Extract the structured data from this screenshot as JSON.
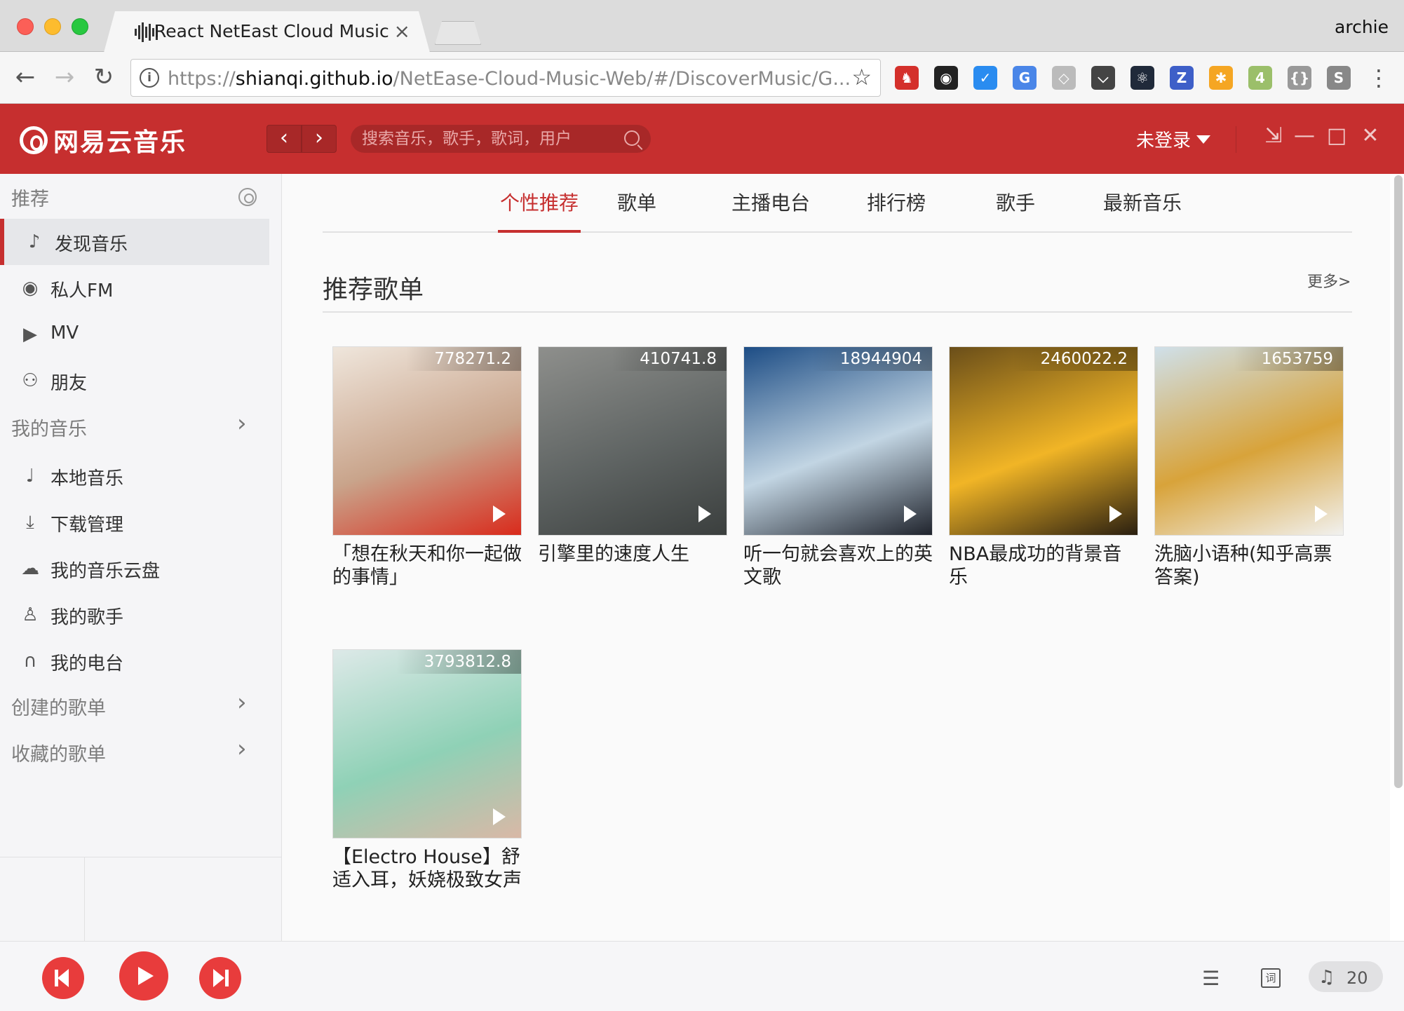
{
  "browser": {
    "tab_title": "React NetEast Cloud Music",
    "profile_name": "archie",
    "url_scheme": "https://",
    "url_host": "shianqi.github.io",
    "url_path": "/NetEase-Cloud-Music-Web/#/DiscoverMusic/G...",
    "extensions": [
      {
        "name": "red-horse-extension-icon",
        "color": "#d4302b",
        "glyph": "♞"
      },
      {
        "name": "spy-glasses-extension-icon",
        "color": "#222222",
        "glyph": "◉"
      },
      {
        "name": "pocket-save-extension-icon",
        "color": "#2a8cf0",
        "glyph": "✓"
      },
      {
        "name": "translate-extension-icon",
        "color": "#4a86e8",
        "glyph": "G"
      },
      {
        "name": "shield-extension-icon",
        "color": "#bbbbbb",
        "glyph": "◇"
      },
      {
        "name": "pocket-extension-icon",
        "color": "#444444",
        "glyph": "⌵"
      },
      {
        "name": "react-devtools-icon",
        "color": "#202a3a",
        "glyph": "⚛"
      },
      {
        "name": "z-extension-icon",
        "color": "#3e5fc8",
        "glyph": "Z"
      },
      {
        "name": "pinwheel-extension-icon",
        "color": "#f5a623",
        "glyph": "✱"
      },
      {
        "name": "badge-extension-icon",
        "color": "#9bbf6a",
        "glyph": "4"
      },
      {
        "name": "json-extension-icon",
        "color": "#999999",
        "glyph": "{}"
      },
      {
        "name": "s-extension-icon",
        "color": "#888888",
        "glyph": "S"
      }
    ]
  },
  "header": {
    "logo_text": "网易云音乐",
    "search_placeholder": "搜索音乐，歌手，歌词，用户",
    "login_label": "未登录"
  },
  "sidebar": {
    "section_recommend": "推荐",
    "recommend_items": [
      {
        "label": "发现音乐",
        "icon": "music-note-icon"
      },
      {
        "label": "私人FM",
        "icon": "radio-icon"
      },
      {
        "label": "MV",
        "icon": "video-icon"
      },
      {
        "label": "朋友",
        "icon": "friends-icon"
      }
    ],
    "section_my_music": "我的音乐",
    "my_music_items": [
      {
        "label": "本地音乐",
        "icon": "local-music-icon"
      },
      {
        "label": "下载管理",
        "icon": "download-icon"
      },
      {
        "label": "我的音乐云盘",
        "icon": "cloud-icon"
      },
      {
        "label": "我的歌手",
        "icon": "singer-icon"
      },
      {
        "label": "我的电台",
        "icon": "podcast-icon"
      }
    ],
    "section_created": "创建的歌单",
    "section_collected": "收藏的歌单"
  },
  "main": {
    "tabs": [
      "个性推荐",
      "歌单",
      "主播电台",
      "排行榜",
      "歌手",
      "最新音乐"
    ],
    "active_tab": "个性推荐",
    "section_title": "推荐歌单",
    "more_label": "更多>",
    "playlists": [
      {
        "count": "778271.2",
        "title": "「想在秋天和你一起做的事情」",
        "colors": [
          "#efe6dc",
          "#c9a48b",
          "#d92b1c"
        ]
      },
      {
        "count": "410741.8",
        "title": "引擎里的速度人生",
        "colors": [
          "#8e8f8c",
          "#5f6463",
          "#3b3f3e"
        ]
      },
      {
        "count": "18944904",
        "title": "听一句就会喜欢上的英文歌",
        "colors": [
          "#1d4d85",
          "#c2d5e3",
          "#20242d"
        ]
      },
      {
        "count": "2460022.2",
        "title": "NBA最成功的背景音乐",
        "colors": [
          "#6a4e19",
          "#f1b526",
          "#2a1f10"
        ]
      },
      {
        "count": "1653759",
        "title": "洗脑小语种(知乎高票答案)",
        "colors": [
          "#cfe0ea",
          "#d8a33a",
          "#f1f1ef"
        ]
      },
      {
        "count": "3793812.8",
        "title": "【Electro House】舒适入耳，妖娆极致女声",
        "colors": [
          "#dde9e8",
          "#8fd1b6",
          "#d9b8a6"
        ]
      }
    ]
  },
  "player": {
    "playlist_count": "20",
    "lyric_label": "词"
  },
  "colors": {
    "brand_red": "#c62f2f",
    "sidebar_bg": "#f5f5f7"
  }
}
